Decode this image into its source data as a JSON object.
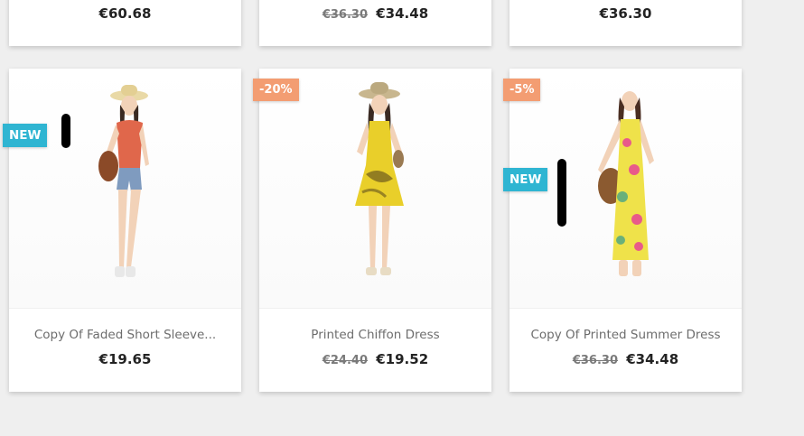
{
  "top_row": [
    {
      "price": "€60.68",
      "old_price": ""
    },
    {
      "price": "€34.48",
      "old_price": "€36.30"
    },
    {
      "price": "€36.30",
      "old_price": ""
    }
  ],
  "products": [
    {
      "name": "Copy Of Faded Short Sleeve...",
      "price": "€19.65",
      "old_price": "",
      "discount": "",
      "new_label": "NEW"
    },
    {
      "name": "Printed Chiffon Dress",
      "price": "€19.52",
      "old_price": "€24.40",
      "discount": "-20%",
      "new_label": ""
    },
    {
      "name": "Copy Of Printed Summer Dress",
      "price": "€34.48",
      "old_price": "€36.30",
      "discount": "-5%",
      "new_label": "NEW"
    }
  ],
  "colors": {
    "discount_badge": "#f39d72",
    "new_badge": "#2fb5d2"
  },
  "icons": {
    "product_images": [
      "woman-straw-hat-red-top-shorts",
      "woman-hat-yellow-printed-dress",
      "woman-floral-maxi-dress"
    ]
  }
}
